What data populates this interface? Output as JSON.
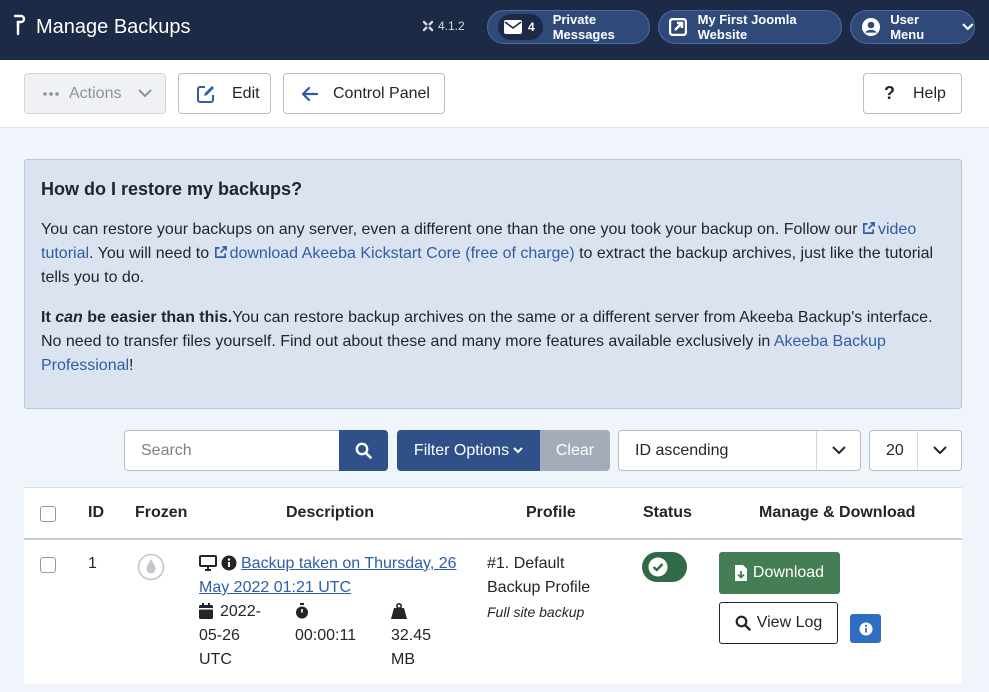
{
  "header": {
    "title": "Manage Backups",
    "version": "4.1.2",
    "messages": {
      "count": "4",
      "label": "Private Messages"
    },
    "site_label": "My First Joomla Website",
    "user_label": "User Menu"
  },
  "toolbar": {
    "actions_label": "Actions",
    "edit_label": "Edit",
    "control_panel_label": "Control Panel",
    "help_label": "Help"
  },
  "info": {
    "heading": "How do I restore my backups?",
    "p1_start": "You can restore your backups on any server, even a different one than the one you took your backup on. Follow our ",
    "p1_link1": "video tutorial",
    "p1_mid": ". You will need to ",
    "p1_link2": "download Akeeba Kickstart Core (free of charge)",
    "p1_end": " to extract the backup archives, just like the tutorial tells you to do.",
    "p2_bold1": "It ",
    "p2_bold_italic": "can",
    "p2_bold2": " be easier than this.",
    "p2_text": "You can restore backup archives on the same or a different server from Akeeba Backup's interface. No need to transfer files yourself. Find out about these and many more features available exclusively in ",
    "p2_link": "Akeeba Backup Professional",
    "p2_end": "!"
  },
  "filters": {
    "search_placeholder": "Search",
    "filter_options_label": "Filter Options",
    "clear_label": "Clear",
    "ordering_value": "ID ascending",
    "limit_value": "20"
  },
  "table": {
    "headers": {
      "id": "ID",
      "frozen": "Frozen",
      "description": "Description",
      "profile": "Profile",
      "status": "Status",
      "manage": "Manage & Download"
    },
    "rows": [
      {
        "id": "1",
        "description_line1": "Backup taken on Thursday, 26",
        "description_line2": "May 2022 01:21 UTC",
        "date_line1": "2022-",
        "date_line2": "05-26",
        "date_line3": "UTC",
        "duration": "00:00:11",
        "size_line1": "32.45",
        "size_line2": "MB",
        "profile_line1": "#1. Default",
        "profile_line2": "Backup Profile",
        "profile_type": "Full site backup",
        "download_label": "Download",
        "view_log_label": "View Log"
      }
    ]
  },
  "colors": {
    "header_bg": "#1c2a45",
    "primary": "#2f5088",
    "success": "#457d54",
    "link": "#2d5ea6",
    "info_bg": "#dce3f0"
  }
}
